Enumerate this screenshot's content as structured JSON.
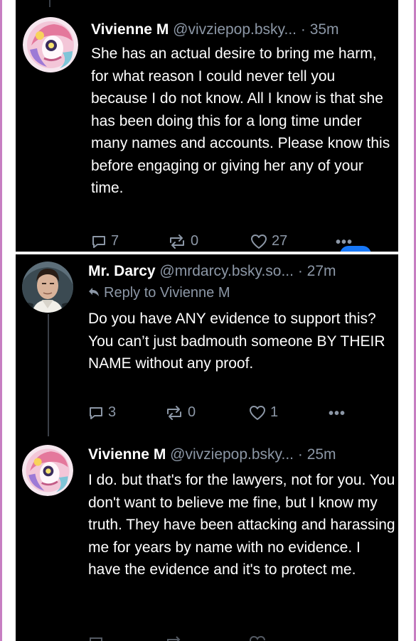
{
  "post1": {
    "display_name": "Vivienne M",
    "handle": "@vivziepop.bsky...",
    "separator": "·",
    "time": "35m",
    "text": "She has an actual desire to bring me harm, for what reason I could never tell you because I do not know. All I know is that she has been doing this for a long time under many names and accounts. Please know this before engaging or giving her any of your time.",
    "replies": "7",
    "reposts": "0",
    "likes": "27",
    "more": "•••"
  },
  "post2": {
    "display_name": "Mr. Darcy",
    "handle": "@mrdarcy.bsky.so...",
    "separator": "·",
    "time": "27m",
    "reply_to": "Reply to Vivienne M",
    "text": "Do you have ANY evidence to support this? You can’t just badmouth someone BY THEIR NAME without any proof.",
    "replies": "3",
    "reposts": "0",
    "likes": "1",
    "more": "•••"
  },
  "post3": {
    "display_name": "Vivienne M",
    "handle": "@vivziepop.bsky...",
    "separator": "·",
    "time": "25m",
    "text": "I do. but that's for the lawyers, not for you. You don't want to believe me fine, but I know my truth. They have been attacking and harassing me for years by name with no evidence. I have the evidence and it's to protect me."
  },
  "colors": {
    "background": "#000000",
    "text": "#ffffff",
    "muted": "#8c97a6",
    "accent_border": "#c77ec2",
    "thread_line": "#3a3f47"
  },
  "icons": [
    "reply-icon",
    "repost-icon",
    "like-icon",
    "more-icon",
    "reply-arrow-icon"
  ]
}
